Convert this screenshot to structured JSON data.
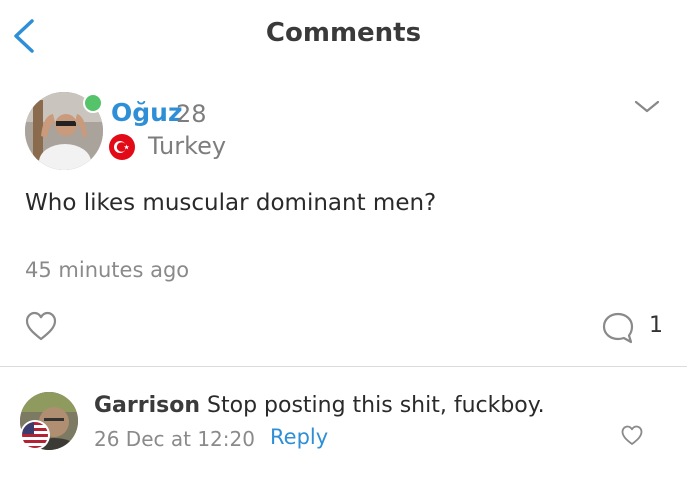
{
  "header": {
    "title": "Comments",
    "back_icon": "chevron-left-icon"
  },
  "post": {
    "author": "Oğuz",
    "age": "28",
    "country": "Turkey",
    "online": true,
    "text": "Who likes muscular dominant men?",
    "time": "45 minutes ago",
    "comment_count": "1",
    "icons": [
      "heart-outline-icon",
      "speech-bubble-icon",
      "chevron-down-icon"
    ]
  },
  "comment": {
    "author": "Garrison",
    "text": "Stop posting this shit, fuckboy.",
    "date": "26 Dec at 12:20",
    "reply_label": "Reply"
  },
  "colors": {
    "accent": "#2f8fd6",
    "online": "#55c36a",
    "muted": "#8a8a8a"
  }
}
